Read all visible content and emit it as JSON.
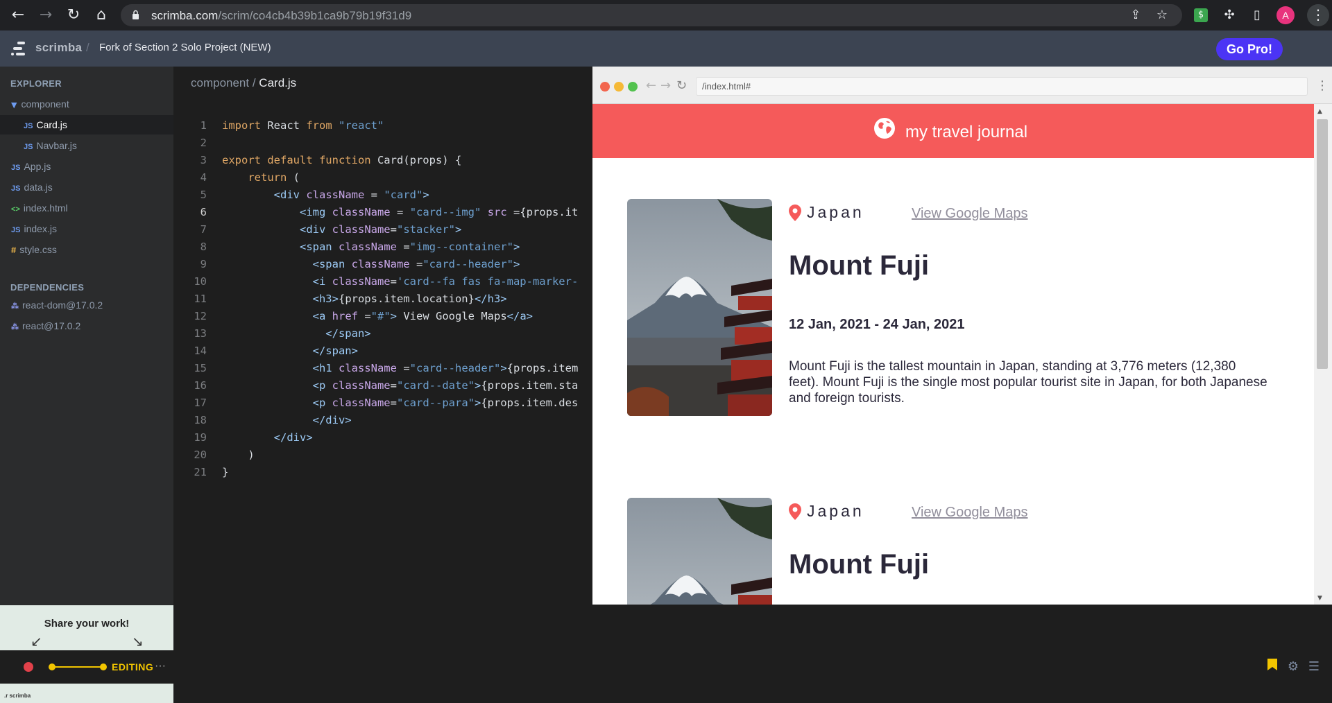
{
  "browser": {
    "url_host": "scrimba.com",
    "url_path": "/scrim/co4cb4b39b1ca9b79b19f31d9",
    "profile_initial": "A",
    "ext_label": "$"
  },
  "header": {
    "brand": "scrimba",
    "separator": "/",
    "project_title": "Fork of Section 2 Solo Project (NEW)",
    "go_pro_label": "Go Pro!"
  },
  "sidebar": {
    "explorer_heading": "EXPLORER",
    "folder": "component",
    "files": [
      {
        "type": "JS",
        "name": "Card.js",
        "selected": true
      },
      {
        "type": "JS",
        "name": "Navbar.js"
      },
      {
        "type": "JS",
        "name": "App.js"
      },
      {
        "type": "JS",
        "name": "data.js"
      },
      {
        "type": "<>",
        "name": "index.html"
      },
      {
        "type": "JS",
        "name": "index.js"
      },
      {
        "type": "#",
        "name": "style.css"
      }
    ],
    "dependencies_heading": "DEPENDENCIES",
    "dependencies": [
      "react-dom@17.0.2",
      "react@17.0.2"
    ],
    "share_title": "Share your work!",
    "share_mark": ".r scrimba"
  },
  "editor": {
    "breadcrumb_folder": "component /",
    "breadcrumb_file": "Card.js",
    "current_line": 6,
    "lines": [
      "import React from \"react\"",
      "",
      "export default function Card(props) {",
      "    return (",
      "        <div className = \"card\">",
      "            <img className = \"card--img\" src ={props.it",
      "            <div className=\"stacker\">",
      "            <span className =\"img--container\">",
      "              <span className =\"card--header\">",
      "              <i className='card--fa fas fa-map-marker-",
      "              <h3>{props.item.location}</h3>",
      "              <a href =\"#\"> View Google Maps</a>",
      "                </span>",
      "              </span>",
      "              <h1 className =\"card--header\">{props.item",
      "              <p className=\"card--date\">{props.item.sta",
      "              <p className=\"card--para\">{props.item.des",
      "              </div>",
      "        </div>",
      "    )",
      "}"
    ]
  },
  "preview": {
    "url": "/index.html#",
    "navbar_title": "my travel journal",
    "cards": [
      {
        "location": "Japan",
        "maps_link": "View Google Maps",
        "title": "Mount Fuji",
        "dates": "12 Jan, 2021 - 24 Jan, 2021",
        "description": "Mount Fuji is the tallest mountain in Japan, standing at 3,776 meters (12,380 feet). Mount Fuji is the single most popular tourist site in Japan, for both Japanese and foreign tourists."
      },
      {
        "location": "Japan",
        "maps_link": "View Google Maps",
        "title": "Mount Fuji"
      }
    ]
  },
  "bottombar": {
    "mode_label": "EDITING",
    "more_label": "···"
  },
  "colors": {
    "accent": "#4b34f5",
    "navbar": "#f55a5a",
    "editing": "#f2c500"
  }
}
